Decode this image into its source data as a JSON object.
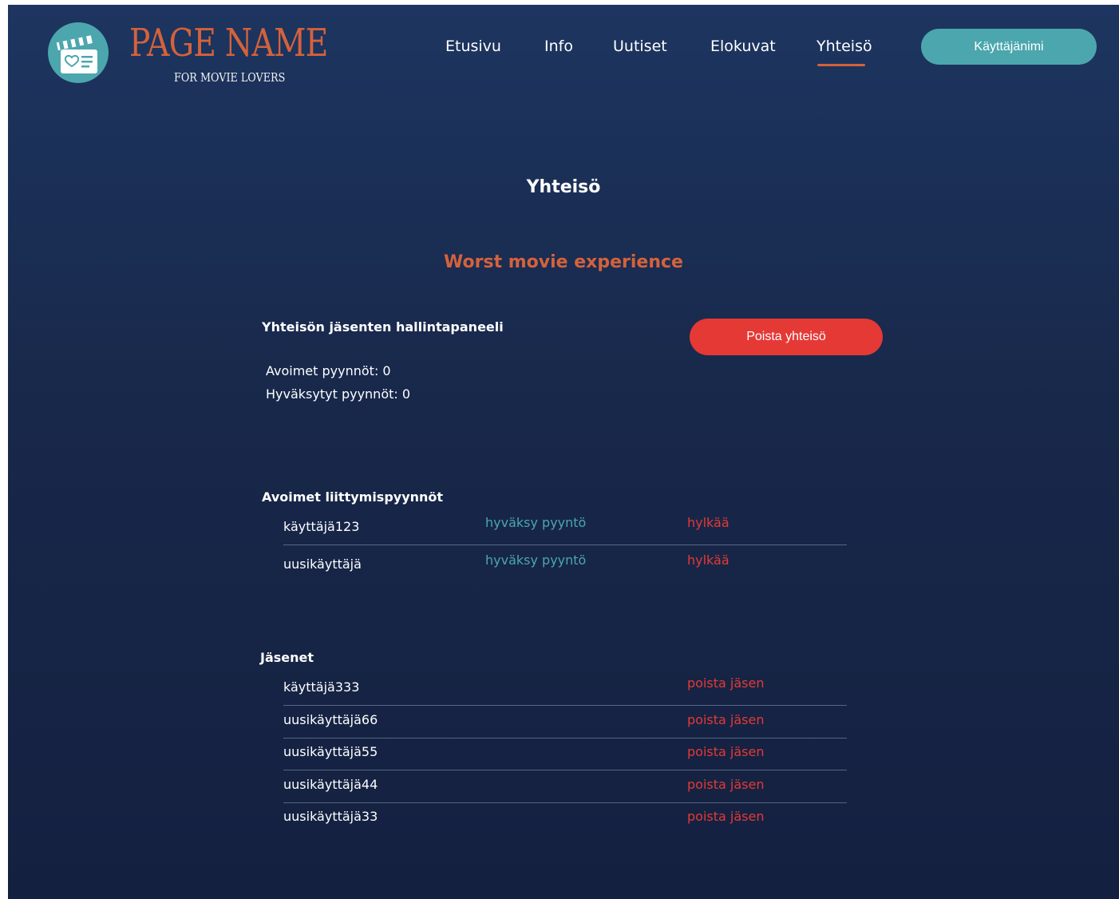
{
  "header": {
    "brand_title": "PAGE NAME",
    "brand_subtitle": "FOR MOVIE LOVERS",
    "logo_icon": "clapperboard-heart-icon",
    "nav": [
      {
        "label": "Etusivu"
      },
      {
        "label": "Info"
      },
      {
        "label": "Uutiset"
      },
      {
        "label": "Elokuvat"
      },
      {
        "label": "Yhteisö",
        "active": true
      }
    ],
    "user_button": "Käyttäjänimi"
  },
  "page": {
    "title": "Yhteisö",
    "community_name": "Worst movie experience"
  },
  "admin_panel": {
    "heading": "Yhteisön jäsenten hallintapaneeli",
    "open_requests": "Avoimet pyynnöt: 0",
    "accepted_requests": "Hyväksytyt pyynnöt: 0",
    "delete_button": "Poista yhteisö"
  },
  "requests": {
    "heading": "Avoimet liittymispyynnöt",
    "items": [
      {
        "username": "käyttäjä123",
        "accept": "hyväksy pyyntö",
        "reject": "hylkää"
      },
      {
        "username": "uusikäyttäjä",
        "accept": "hyväksy pyyntö",
        "reject": "hylkää"
      }
    ]
  },
  "members": {
    "heading": "Jäsenet",
    "items": [
      {
        "username": "käyttäjä333",
        "remove": "poista jäsen"
      },
      {
        "username": "uusikäyttäjä66",
        "remove": "poista jäsen"
      },
      {
        "username": "uusikäyttäjä55",
        "remove": "poista jäsen"
      },
      {
        "username": "uusikäyttäjä44",
        "remove": "poista jäsen"
      },
      {
        "username": "uusikäyttäjä33",
        "remove": "poista jäsen"
      }
    ]
  },
  "colors": {
    "background": "#18284a",
    "accent_orange": "#d4623b",
    "accent_teal": "#4ba7ad",
    "danger_red": "#e53935"
  }
}
